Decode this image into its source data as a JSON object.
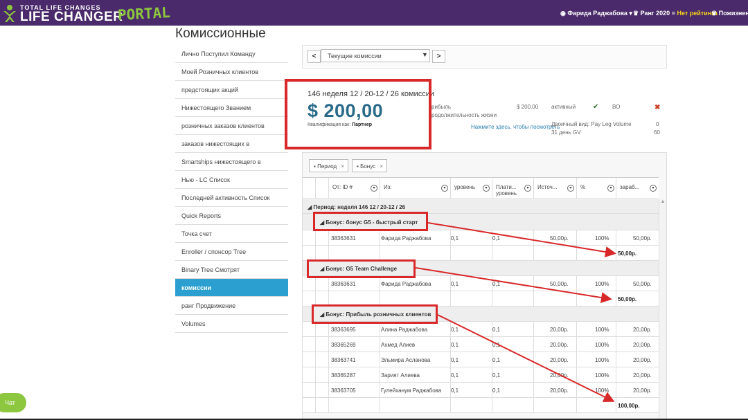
{
  "app": {
    "logo_small": "TOTAL LIFE CHANGES",
    "logo_big": "LIFE CHANGER",
    "logo_portal": "PORTAL",
    "user_name": "Фарида Раджабова",
    "rank_prefix": "Ранг 2020 =",
    "rank_value": "Нет рейтинга",
    "lifetime_label": "Пожизненный"
  },
  "page": {
    "title": "Комиссионные"
  },
  "sidebar": {
    "items": [
      {
        "label": "Лично Поступил Команду"
      },
      {
        "label": "Моей Розничных клиентов"
      },
      {
        "label": "предстоящих акций"
      },
      {
        "label": "Нижестоящего Званием"
      },
      {
        "label": "розничных заказов клиентов"
      },
      {
        "label": "заказов нижестоящих в"
      },
      {
        "label": "Smartships нижестоящего в"
      },
      {
        "label": "Нью - LC Список"
      },
      {
        "label": "Последней активность Список"
      },
      {
        "label": "Quick Reports"
      },
      {
        "label": "Точка счет"
      },
      {
        "label": "Enroller / спонсор Tree"
      },
      {
        "label": "Binary Tree Смотрят"
      },
      {
        "label": "комиссии"
      },
      {
        "label": "ранг Продвижение"
      },
      {
        "label": "Volumes"
      }
    ],
    "active_index": 13
  },
  "selector": {
    "prev": "<",
    "next": ">",
    "value": "Текущие комиссии"
  },
  "summary": {
    "week": "146 неделя 12 / 20-12 / 26 комиссии",
    "amount": "$ 200,00",
    "qual_label": "Квалификация как:",
    "qual_value": "Партнер",
    "profit_label": "рибыль",
    "profit_life_label": "родолжительность жизни",
    "profit_value": "$ 200,00",
    "see_here": "Нажмите здесь, чтобы посмотреть",
    "active_label": "активный",
    "active_pv": "ВО",
    "binary_label": "Двоичный вид: Pay Leg Volume",
    "binary_value": "0",
    "gv_label": "31 день GV",
    "gv_value": "60"
  },
  "filters": {
    "period": "Период",
    "bonus": "Бонус",
    "remove": "×"
  },
  "table": {
    "headers": [
      {
        "line1": "От: ID #",
        "line2": ""
      },
      {
        "line1": "Из:",
        "line2": ""
      },
      {
        "line1": "уровень",
        "line2": ""
      },
      {
        "line1": "Плати...",
        "line2": "уровень"
      },
      {
        "line1": "Источ...",
        "line2": ""
      },
      {
        "line1": "%",
        "line2": ""
      },
      {
        "line1": "зараб...",
        "line2": ""
      }
    ],
    "period_label": "Период: неделя 146 12 / 20-12 / 26",
    "groups": [
      {
        "label": "Бонус: бонус G5 - быстрый старт",
        "rows": [
          {
            "id": "38363631",
            "from": "Фарида Раджабова",
            "level": "0,1",
            "paid_level": "0,1",
            "source": "50,00р.",
            "pct": "100%",
            "earned": "50,00р."
          }
        ],
        "total": "50,00р."
      },
      {
        "label": "Бонус: G5 Team Challenge",
        "rows": [
          {
            "id": "38363631",
            "from": "Фарида Раджабова",
            "level": "0,1",
            "paid_level": "0,1",
            "source": "50,00р.",
            "pct": "100%",
            "earned": "50,00р."
          }
        ],
        "total": "50,00р."
      },
      {
        "label": "Бонус: Прибыль розничных клиентов",
        "rows": [
          {
            "id": "38363695",
            "from": "Алина Раджабова",
            "level": "0,1",
            "paid_level": "0,1",
            "source": "20,00р.",
            "pct": "100%",
            "earned": "20,00р."
          },
          {
            "id": "38365269",
            "from": "Ахмед Алиев",
            "level": "0,1",
            "paid_level": "0,1",
            "source": "20,00р.",
            "pct": "100%",
            "earned": "20,00р."
          },
          {
            "id": "38363741",
            "from": "Эльмира Асланова",
            "level": "0,1",
            "paid_level": "0,1",
            "source": "20,00р.",
            "pct": "100%",
            "earned": "20,00р."
          },
          {
            "id": "38365287",
            "from": "Зарият Алиева",
            "level": "0,1",
            "paid_level": "0,1",
            "source": "20,00р.",
            "pct": "100%",
            "earned": "20,00р."
          },
          {
            "id": "38363705",
            "from": "Гулейханум Раджабова",
            "level": "0,1",
            "paid_level": "0,1",
            "source": "20,00р.",
            "pct": "100%",
            "earned": "20,00р."
          }
        ],
        "total": "100,00р."
      }
    ]
  },
  "chat": {
    "label": "Чат"
  },
  "colors": {
    "topbar": "#4a2a6a",
    "accent": "#2a9fd0",
    "highlight": "#d8282a",
    "brand_green": "#8dc63f"
  }
}
